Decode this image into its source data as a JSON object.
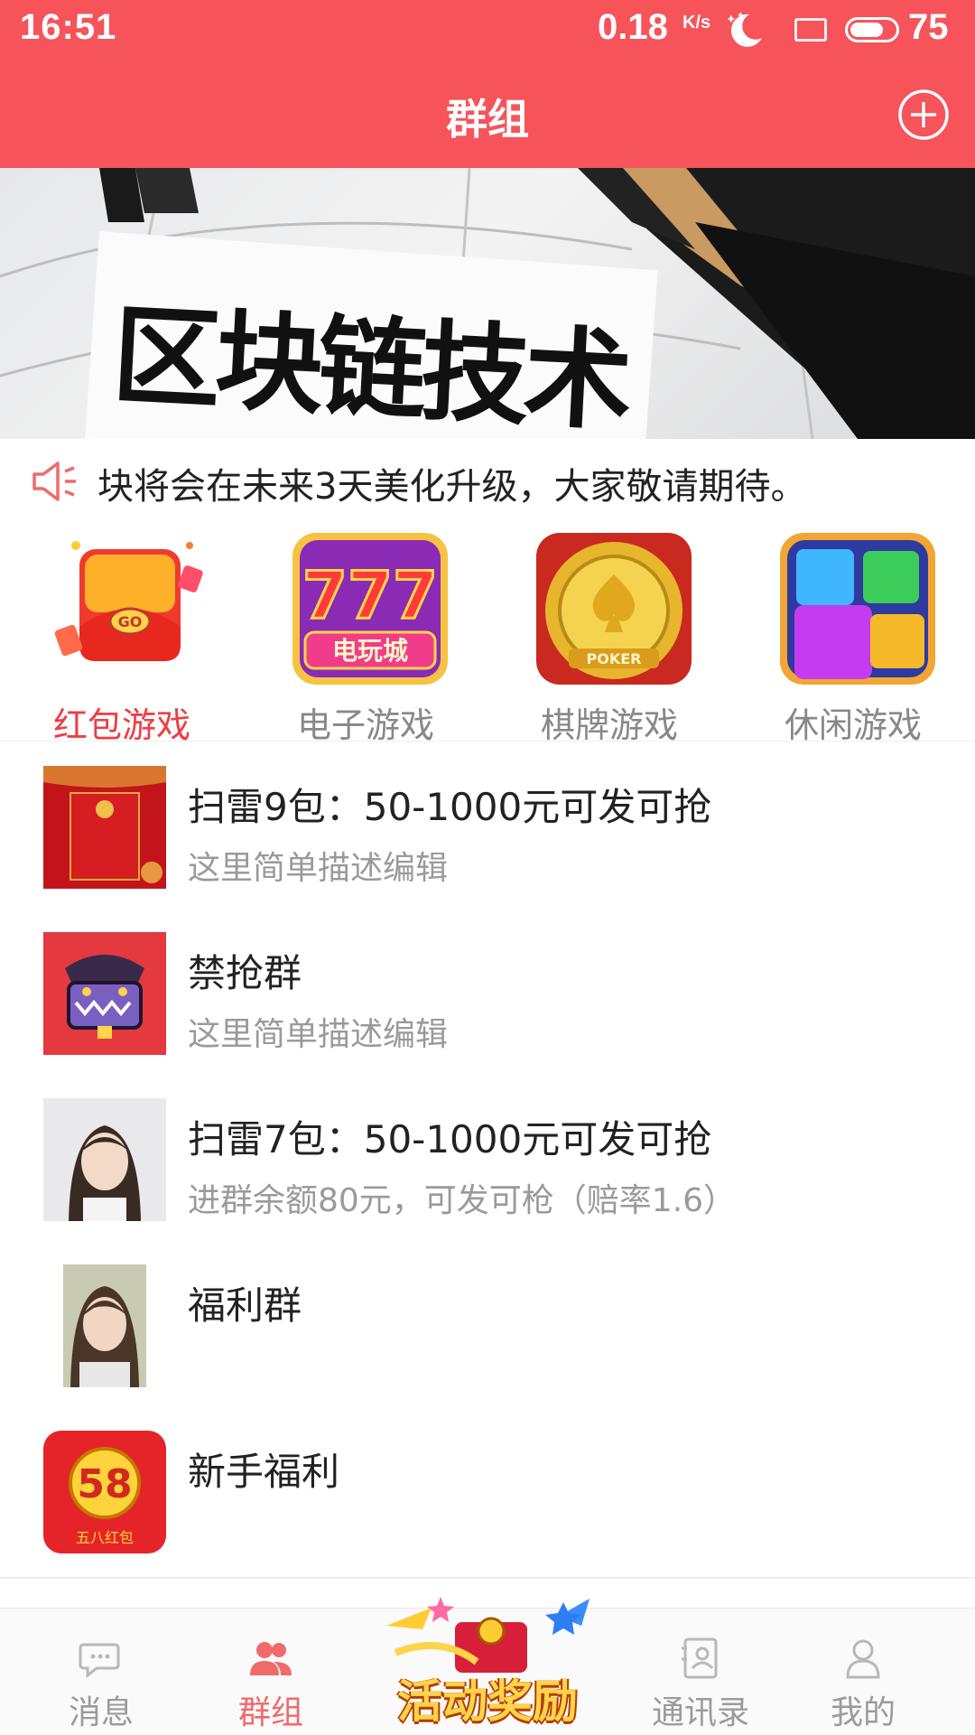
{
  "status_bar": {
    "time": "16:51",
    "net_speed": "0.18",
    "net_speed_unit": "K/s",
    "battery_level": "75",
    "battery_fraction": 0.75
  },
  "header": {
    "title": "群组",
    "add_icon": "plus-circle-icon"
  },
  "banner": {
    "text": "区块链技术",
    "slide_count": 3,
    "active_slide": 2
  },
  "notice": {
    "icon": "speaker-icon",
    "text": "块将会在未来3天美化升级，大家敬请期待。"
  },
  "categories": [
    {
      "label": "红包游戏",
      "active": true,
      "icon": "red-packet-go-icon"
    },
    {
      "label": "电子游戏",
      "active": false,
      "icon": "slot-777-icon"
    },
    {
      "label": "棋牌游戏",
      "active": false,
      "icon": "poker-chip-icon"
    },
    {
      "label": "休闲游戏",
      "active": false,
      "icon": "gem-blocks-icon"
    }
  ],
  "groups": [
    {
      "title": "扫雷9包：50-1000元可发可抢",
      "subtitle": "这里简单描述编辑",
      "avatar": "red-envelope-avatar"
    },
    {
      "title": "禁抢群",
      "subtitle": "这里简单描述编辑",
      "avatar": "monster-chest-avatar"
    },
    {
      "title": "扫雷7包：50-1000元可发可抢",
      "subtitle": "进群余额80元，可发可枪（赔率1.6）",
      "avatar": "girl-photo-avatar"
    },
    {
      "title": "福利群",
      "subtitle": "",
      "avatar": "girl-photo-avatar-2"
    },
    {
      "title": "新手福利",
      "subtitle": "",
      "avatar": "58-red-packet-avatar"
    }
  ],
  "tabbar": {
    "tabs": [
      {
        "label": "消息",
        "icon": "chat-bubble-icon",
        "active": false
      },
      {
        "label": "群组",
        "icon": "people-icon",
        "active": true
      },
      {
        "label": "通讯录",
        "icon": "contacts-book-icon",
        "active": false
      },
      {
        "label": "我的",
        "icon": "person-icon",
        "active": false
      }
    ],
    "promo_label": "活动奖励",
    "promo_icon": "reward-burst-icon"
  },
  "colors": {
    "brand_red": "#f6535a",
    "active_label": "#ef3c45",
    "inactive_label": "#888888"
  }
}
